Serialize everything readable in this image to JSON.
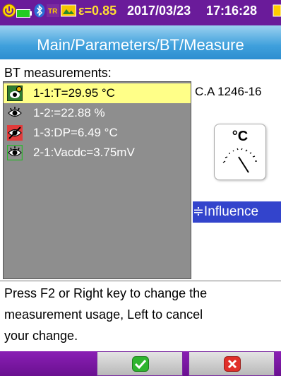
{
  "status_bar": {
    "emissivity_text": "ε=0.85",
    "date": "2017/03/23",
    "time": "17:16:28",
    "icons": [
      "power-icon",
      "battery-icon",
      "bluetooth-icon",
      "thermal-icon",
      "image-icon",
      "memory-icon"
    ]
  },
  "breadcrumb": "Main/Parameters/BT/Measure",
  "section_label": "BT measurements:",
  "measurements": [
    {
      "label": "1-1:T=29.95 °C",
      "icon": "active-eye-icon",
      "selected": true
    },
    {
      "label": "1-2:=22.88 %",
      "icon": "eye-icon",
      "selected": false
    },
    {
      "label": "1-3:DP=6.49 °C",
      "icon": "eye-disabled-icon",
      "selected": false
    },
    {
      "label": "2-1:Vacdc=3.75mV",
      "icon": "eye-icon",
      "selected": false
    }
  ],
  "device": {
    "name": "C.A 1246-16",
    "unit": "°C",
    "gauge_icon": "analog-gauge-icon"
  },
  "influence_button": "≑Influence",
  "help_lines": [
    "Press F2 or Right key to change the",
    "measurement usage, Left to cancel",
    "your change."
  ],
  "function_keys": {
    "ok_icon": "check-icon",
    "cancel_icon": "x-icon"
  },
  "colors": {
    "status_bar": "#6a1b9a",
    "header_blue": "#3fa0dc",
    "selected_row": "#ffff88",
    "list_background": "#8e8e8e",
    "influence": "#3344cc",
    "ok_green": "#2fb52f",
    "cancel_red": "#e0302a"
  }
}
